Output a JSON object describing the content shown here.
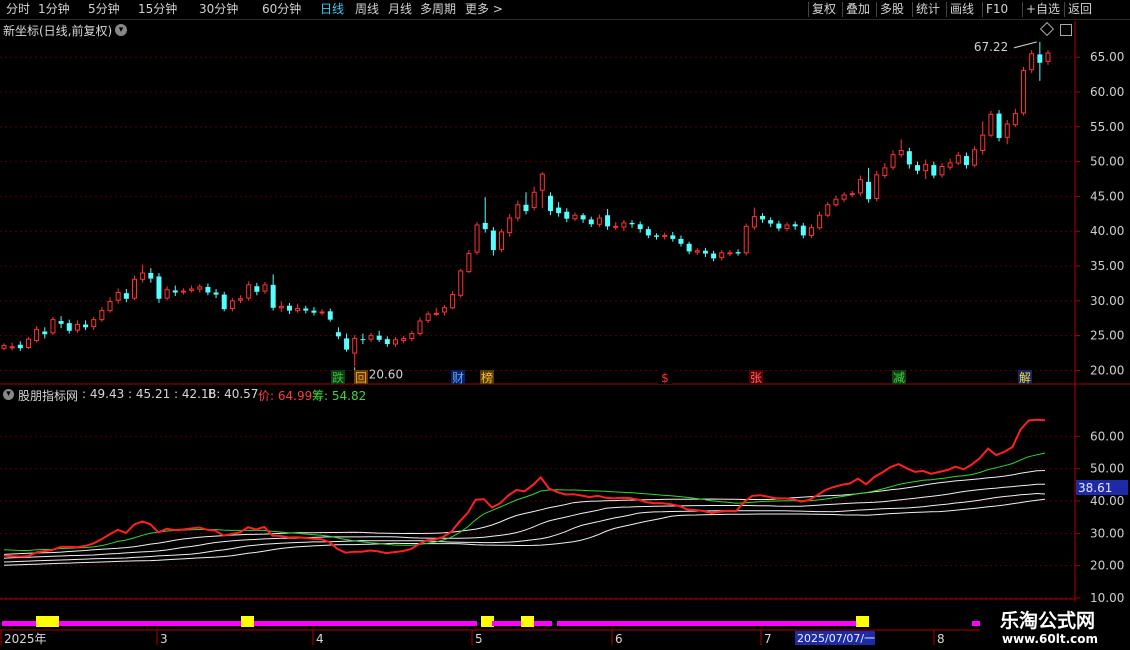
{
  "toolbar": {
    "periods": [
      "分时",
      "1分钟",
      "5分钟",
      "15分钟",
      "30分钟",
      "60分钟",
      "日线",
      "周线",
      "月线",
      "多周期",
      "更多"
    ],
    "active": "日线",
    "right_buttons": [
      "复权",
      "叠加",
      "多股",
      "统计",
      "画线",
      "F10",
      "+自选",
      "返回"
    ]
  },
  "main_panel": {
    "title": "新坐标(日线,前复权)",
    "high_marker": "67.22",
    "low_marker": "20.60",
    "y_ticks": [
      "65.00",
      "60.00",
      "55.00",
      "50.00",
      "45.00",
      "40.00",
      "35.00",
      "30.00",
      "25.00",
      "20.00"
    ],
    "events": [
      {
        "text": "跌",
        "color": "#2fbf3f",
        "bg": "#0f3f10"
      },
      {
        "text": "回",
        "color": "#e0a040",
        "bg": "#6a3a00"
      },
      {
        "text": "财",
        "color": "#5aa8ff",
        "bg": "#0a2060"
      },
      {
        "text": "榜",
        "color": "#f0c040",
        "bg": "#5a3a00"
      },
      {
        "text": "$",
        "color": "#ff3030",
        "bg": "#000000"
      },
      {
        "text": "张",
        "color": "#ff6060",
        "bg": "#5a0000"
      },
      {
        "text": "减",
        "color": "#40d040",
        "bg": "#104010"
      },
      {
        "text": "解",
        "color": "#e0e040",
        "bg": "#202060"
      }
    ]
  },
  "indicator_panel": {
    "name": "股朋指标网",
    "values": ": 49.43 : 45.21 : 42.18",
    "b_value": "B: 40.57",
    "price_label": "价: 64.99",
    "chip_label": "筹: 54.82",
    "y_ticks": [
      "60.00",
      "50.00",
      "40.00",
      "30.00",
      "20.00",
      "10.00"
    ],
    "current_value": "38.61"
  },
  "x_axis": {
    "labels": [
      "2025年",
      "3",
      "4",
      "5",
      "6",
      "7",
      "8"
    ],
    "date_cursor": "2025/07/07/一"
  },
  "watermark": {
    "title": "乐淘公式网",
    "url": "www.60lt.com"
  },
  "colors": {
    "up": "#ff3232",
    "down": "#54ffff",
    "grid": "#5a0000",
    "price_line": "#ff2020",
    "chip_line": "#2ed82e",
    "bar_magenta": "#ff00ff",
    "bar_yellow": "#ffff00"
  },
  "chart_data": {
    "type": "candlestick",
    "title": "新坐标(日线,前复权)",
    "ylim": [
      18.2,
      70.2
    ],
    "candles": [
      [
        23.2,
        23.6,
        23.9,
        22.9
      ],
      [
        23.4,
        23.4,
        24.0,
        22.9
      ],
      [
        23.7,
        23.2,
        24.2,
        22.8
      ],
      [
        23.3,
        24.5,
        24.8,
        23.1
      ],
      [
        24.3,
        25.9,
        26.4,
        24.0
      ],
      [
        25.6,
        25.2,
        26.2,
        24.6
      ],
      [
        25.4,
        27.3,
        27.7,
        25.1
      ],
      [
        27.1,
        26.7,
        27.8,
        26.1
      ],
      [
        26.8,
        25.7,
        27.3,
        25.3
      ],
      [
        25.8,
        26.6,
        27.2,
        25.4
      ],
      [
        26.6,
        26.2,
        27.2,
        25.8
      ],
      [
        26.3,
        27.3,
        27.7,
        25.8
      ],
      [
        27.3,
        28.6,
        29.1,
        27.0
      ],
      [
        28.6,
        29.9,
        30.5,
        28.3
      ],
      [
        30.1,
        31.2,
        31.8,
        29.6
      ],
      [
        31.1,
        30.3,
        31.7,
        29.8
      ],
      [
        30.4,
        33.1,
        33.6,
        30.1
      ],
      [
        33.1,
        34.0,
        35.2,
        32.6
      ],
      [
        34.0,
        33.2,
        34.7,
        32.6
      ],
      [
        33.5,
        30.3,
        34.0,
        29.7
      ],
      [
        30.4,
        31.6,
        32.1,
        30.1
      ],
      [
        31.5,
        31.2,
        32.2,
        30.7
      ],
      [
        31.3,
        31.4,
        31.8,
        30.9
      ],
      [
        31.5,
        31.7,
        32.2,
        31.2
      ],
      [
        31.7,
        32.0,
        32.4,
        31.2
      ],
      [
        32.0,
        31.2,
        32.5,
        30.8
      ],
      [
        31.2,
        30.9,
        31.7,
        30.4
      ],
      [
        30.9,
        28.8,
        31.3,
        28.5
      ],
      [
        28.9,
        30.0,
        30.4,
        28.5
      ],
      [
        30.1,
        30.3,
        30.8,
        29.7
      ],
      [
        30.4,
        32.3,
        32.8,
        30.0
      ],
      [
        32.1,
        31.3,
        32.6,
        30.8
      ],
      [
        31.4,
        32.3,
        32.7,
        31.0
      ],
      [
        32.3,
        29.0,
        33.8,
        28.6
      ],
      [
        29.0,
        29.2,
        29.9,
        28.4
      ],
      [
        29.3,
        28.6,
        29.7,
        28.1
      ],
      [
        28.6,
        28.9,
        29.6,
        28.3
      ],
      [
        28.9,
        28.6,
        29.3,
        28.2
      ],
      [
        28.6,
        28.3,
        29.1,
        27.9
      ],
      [
        28.3,
        28.4,
        28.8,
        27.9
      ],
      [
        28.5,
        27.3,
        28.9,
        27.0
      ],
      [
        25.5,
        24.9,
        26.2,
        24.5
      ],
      [
        24.6,
        23.0,
        25.3,
        22.7
      ],
      [
        22.5,
        24.6,
        25.1,
        20.6
      ],
      [
        24.5,
        24.4,
        25.3,
        23.8
      ],
      [
        24.5,
        25.0,
        25.4,
        24.1
      ],
      [
        25.0,
        24.4,
        25.7,
        24.1
      ],
      [
        24.5,
        23.8,
        24.9,
        23.4
      ],
      [
        23.8,
        24.4,
        24.8,
        23.4
      ],
      [
        24.3,
        24.6,
        25.0,
        23.9
      ],
      [
        24.6,
        25.3,
        25.7,
        24.2
      ],
      [
        25.3,
        27.1,
        27.6,
        25.0
      ],
      [
        27.2,
        28.1,
        28.5,
        26.8
      ],
      [
        28.1,
        28.2,
        29.0,
        27.8
      ],
      [
        28.4,
        29.0,
        29.4,
        27.9
      ],
      [
        29.0,
        30.9,
        31.4,
        28.8
      ],
      [
        30.8,
        34.3,
        34.6,
        30.5
      ],
      [
        34.2,
        36.8,
        37.3,
        34.0
      ],
      [
        37.0,
        40.9,
        41.3,
        36.6
      ],
      [
        41.2,
        40.3,
        44.9,
        39.8
      ],
      [
        40.1,
        37.3,
        40.6,
        36.5
      ],
      [
        37.4,
        39.9,
        40.3,
        37.0
      ],
      [
        39.8,
        41.9,
        42.5,
        39.2
      ],
      [
        41.9,
        43.8,
        44.4,
        41.4
      ],
      [
        43.8,
        42.9,
        45.6,
        42.4
      ],
      [
        43.4,
        45.6,
        46.4,
        43.0
      ],
      [
        45.9,
        48.2,
        48.5,
        43.3
      ],
      [
        45.1,
        42.9,
        45.6,
        42.3
      ],
      [
        43.4,
        42.6,
        44.2,
        42.1
      ],
      [
        42.8,
        41.8,
        43.3,
        41.3
      ],
      [
        41.8,
        42.3,
        42.7,
        41.5
      ],
      [
        42.3,
        41.7,
        42.6,
        41.2
      ],
      [
        41.7,
        41.0,
        42.1,
        40.6
      ],
      [
        41.0,
        41.9,
        42.4,
        40.6
      ],
      [
        42.3,
        40.7,
        43.2,
        40.2
      ],
      [
        40.7,
        40.7,
        41.3,
        40.2
      ],
      [
        40.6,
        41.2,
        41.6,
        40.0
      ],
      [
        41.2,
        41.0,
        41.6,
        40.5
      ],
      [
        41.0,
        40.3,
        41.4,
        39.8
      ],
      [
        40.3,
        39.4,
        40.7,
        39.0
      ],
      [
        39.4,
        39.2,
        39.7,
        38.8
      ],
      [
        39.3,
        39.4,
        39.8,
        38.8
      ],
      [
        39.4,
        38.9,
        39.9,
        38.5
      ],
      [
        38.9,
        38.2,
        39.4,
        37.8
      ],
      [
        38.2,
        37.1,
        38.5,
        36.7
      ],
      [
        37.0,
        37.2,
        37.6,
        36.6
      ],
      [
        37.2,
        36.8,
        37.6,
        36.3
      ],
      [
        36.8,
        36.1,
        37.2,
        35.7
      ],
      [
        36.2,
        36.9,
        37.3,
        35.8
      ],
      [
        36.9,
        36.9,
        37.3,
        36.4
      ],
      [
        37.0,
        36.8,
        37.4,
        36.5
      ],
      [
        36.9,
        40.7,
        41.1,
        36.5
      ],
      [
        40.6,
        42.1,
        43.4,
        40.2
      ],
      [
        42.2,
        41.7,
        42.6,
        41.2
      ],
      [
        41.6,
        41.1,
        42.0,
        40.6
      ],
      [
        41.1,
        40.4,
        41.5,
        40.0
      ],
      [
        40.4,
        40.9,
        41.3,
        40.0
      ],
      [
        41.0,
        40.7,
        41.4,
        40.2
      ],
      [
        40.8,
        39.4,
        41.2,
        39.0
      ],
      [
        39.4,
        40.5,
        41.0,
        39.0
      ],
      [
        40.5,
        42.3,
        42.8,
        40.2
      ],
      [
        42.3,
        43.8,
        44.2,
        42.0
      ],
      [
        43.8,
        44.6,
        45.1,
        43.5
      ],
      [
        44.6,
        45.2,
        45.6,
        44.2
      ],
      [
        45.3,
        45.4,
        45.8,
        44.9
      ],
      [
        45.5,
        47.4,
        48.0,
        45.1
      ],
      [
        47.1,
        44.6,
        49.1,
        44.1
      ],
      [
        44.7,
        48.1,
        48.7,
        44.3
      ],
      [
        48.0,
        49.1,
        49.8,
        47.6
      ],
      [
        49.2,
        51.0,
        51.6,
        48.8
      ],
      [
        51.0,
        51.6,
        53.2,
        50.6
      ],
      [
        51.5,
        49.6,
        52.0,
        49.0
      ],
      [
        49.5,
        48.7,
        50.0,
        48.2
      ],
      [
        48.7,
        49.6,
        50.3,
        47.5
      ],
      [
        49.5,
        48.0,
        50.0,
        47.6
      ],
      [
        48.1,
        49.3,
        49.8,
        47.7
      ],
      [
        49.2,
        49.8,
        50.4,
        48.8
      ],
      [
        49.8,
        50.9,
        51.4,
        49.5
      ],
      [
        50.8,
        49.5,
        51.3,
        49.0
      ],
      [
        49.5,
        51.7,
        52.2,
        49.2
      ],
      [
        51.6,
        53.8,
        55.8,
        51.0
      ],
      [
        53.8,
        56.8,
        57.3,
        53.5
      ],
      [
        56.9,
        53.4,
        57.4,
        52.9
      ],
      [
        53.5,
        55.4,
        56.0,
        52.5
      ],
      [
        55.3,
        56.9,
        57.6,
        55.0
      ],
      [
        57.0,
        63.1,
        63.6,
        56.6
      ],
      [
        63.2,
        65.5,
        66.0,
        62.7
      ],
      [
        65.4,
        64.2,
        67.2,
        61.6
      ],
      [
        64.4,
        65.6,
        66.0,
        63.9
      ]
    ],
    "indicator_ylim": [
      10,
      70
    ],
    "price_line": [
      23.1,
      22.9,
      22.8,
      23.0,
      24.1,
      24.5,
      24.9,
      25.8,
      25.8,
      25.7,
      26.1,
      26.9,
      28.2,
      29.7,
      31.1,
      30.1,
      32.7,
      33.7,
      32.8,
      30.3,
      31.4,
      31.0,
      31.2,
      31.5,
      31.8,
      31.1,
      30.8,
      29.3,
      29.8,
      30.3,
      31.9,
      31.2,
      32.0,
      29.3,
      29.2,
      28.7,
      28.8,
      28.6,
      28.3,
      28.2,
      27.3,
      25.2,
      24.0,
      24.3,
      24.3,
      24.7,
      24.4,
      23.9,
      24.2,
      24.5,
      25.1,
      26.6,
      27.8,
      28.1,
      28.9,
      30.5,
      33.6,
      36.3,
      40.4,
      40.6,
      38.0,
      39.3,
      41.7,
      43.4,
      43.0,
      44.9,
      47.3,
      43.9,
      42.8,
      42.0,
      42.1,
      41.7,
      41.2,
      41.6,
      41.0,
      40.8,
      41.0,
      40.9,
      40.4,
      39.6,
      39.3,
      39.3,
      39.0,
      38.5,
      37.4,
      37.2,
      36.9,
      36.3,
      36.7,
      36.9,
      36.8,
      39.7,
      41.6,
      41.8,
      41.3,
      40.8,
      40.8,
      40.6,
      39.8,
      40.3,
      41.8,
      43.4,
      44.3,
      45.0,
      45.4,
      46.9,
      45.2,
      47.4,
      48.8,
      50.5,
      51.4,
      50.1,
      49.0,
      49.3,
      48.4,
      49.0,
      49.6,
      50.6,
      49.8,
      51.3,
      53.3,
      56.2,
      54.2,
      55.2,
      56.7,
      62.1,
      64.9,
      65.1,
      64.99
    ],
    "chip_line": [
      24.9,
      24.8,
      24.7,
      24.7,
      24.9,
      25.0,
      25.1,
      25.3,
      25.4,
      25.5,
      25.6,
      25.8,
      26.2,
      26.8,
      27.5,
      27.9,
      28.6,
      29.4,
      30.0,
      30.4,
      30.7,
      30.9,
      31.0,
      31.1,
      31.2,
      31.2,
      31.2,
      31.0,
      30.9,
      30.9,
      30.9,
      30.9,
      30.9,
      30.6,
      30.4,
      30.2,
      30.0,
      29.8,
      29.6,
      29.4,
      29.1,
      28.6,
      28.1,
      27.7,
      27.4,
      27.1,
      26.9,
      26.6,
      26.4,
      26.3,
      26.3,
      26.5,
      26.9,
      27.3,
      27.9,
      28.8,
      30.2,
      32.0,
      34.2,
      36.0,
      37.1,
      38.1,
      39.2,
      40.3,
      41.1,
      42.0,
      43.1,
      43.4,
      43.5,
      43.4,
      43.4,
      43.3,
      43.2,
      43.1,
      43.0,
      42.8,
      42.7,
      42.6,
      42.4,
      42.2,
      42.0,
      41.8,
      41.6,
      41.4,
      41.1,
      40.8,
      40.5,
      40.1,
      39.8,
      39.6,
      39.3,
      39.4,
      39.6,
      39.8,
      39.9,
      40.0,
      40.1,
      40.1,
      40.1,
      40.1,
      40.3,
      40.6,
      41.0,
      41.4,
      41.8,
      42.3,
      42.6,
      43.1,
      43.7,
      44.4,
      45.1,
      45.6,
      46.0,
      46.4,
      46.6,
      46.9,
      47.2,
      47.6,
      47.8,
      48.2,
      48.8,
      49.7,
      50.3,
      50.9,
      51.6,
      52.7,
      53.7,
      54.3,
      54.82
    ],
    "white_lines": [
      {
        "start": 23.5,
        "end": 49.43
      },
      {
        "start": 22.5,
        "end": 45.21
      },
      {
        "start": 21.5,
        "end": 42.18
      },
      {
        "start": 20.8,
        "end": 40.57
      }
    ],
    "signal_bars": [
      {
        "from": 0,
        "to": 31,
        "yellow": [
          7,
          9
        ]
      },
      {
        "from": 30,
        "to": 95,
        "yellow": [
          48,
          96
        ]
      },
      {
        "from": 98,
        "to": 110,
        "yellow": [
          104
        ]
      },
      {
        "from": 111,
        "to": 173,
        "yellow": [
          171
        ]
      },
      {
        "from": 194,
        "to": 198,
        "yellow": [
          196
        ]
      }
    ]
  }
}
